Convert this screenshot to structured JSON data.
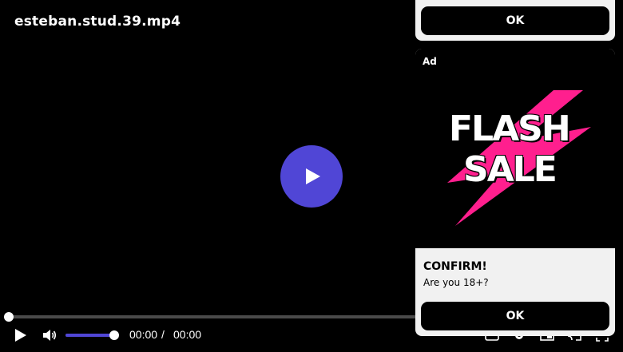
{
  "video": {
    "title": "esteban.stud.39.mp4",
    "current_time": "00:00",
    "separator": "/",
    "duration": "00:00",
    "progress": 0.0,
    "volume": 1.0
  },
  "colors": {
    "accent": "#5046d6",
    "ad_pink": "#ff1f8e",
    "popup_bg": "#f1f1f1",
    "button_bg": "#000000"
  },
  "icons": {
    "big_play": "play-icon",
    "play": "play-icon",
    "volume": "volume-icon",
    "cc": "captions-icon",
    "settings": "gear-icon",
    "pip": "picture-in-picture-icon",
    "cast": "cast-icon",
    "fullscreen": "fullscreen-icon"
  },
  "popup_top": {
    "ok_label": "OK"
  },
  "ad_popup": {
    "ad_label": "Ad",
    "image_words": [
      "FLASH",
      "SALE"
    ],
    "confirm_title": "CONFIRM!",
    "confirm_message": "Are you 18+?",
    "ok_label": "OK"
  }
}
